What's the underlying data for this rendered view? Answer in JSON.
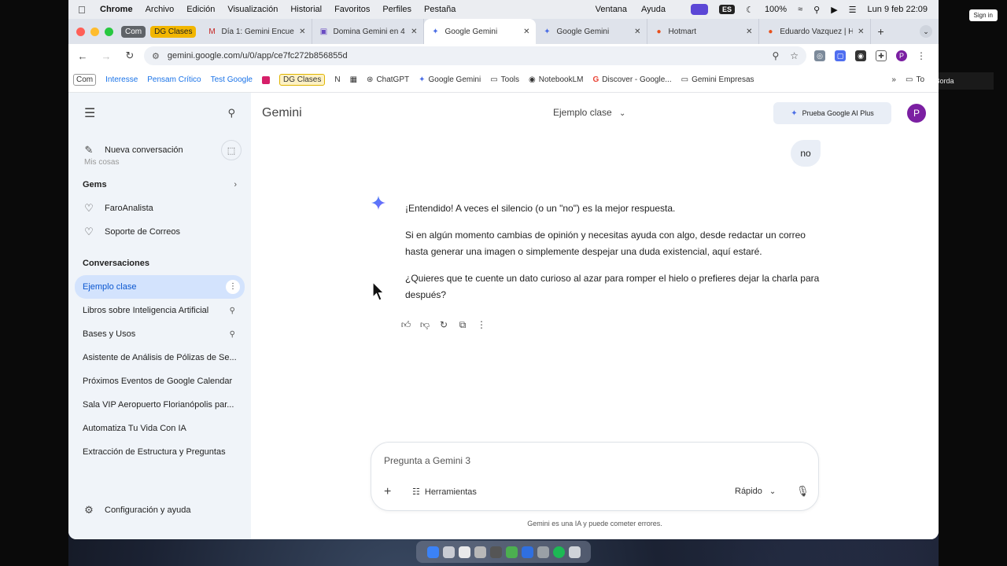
{
  "menubar": {
    "app": "Chrome",
    "items": [
      "Archivo",
      "Edición",
      "Visualización",
      "Historial",
      "Favoritos",
      "Perfiles",
      "Pestaña"
    ],
    "right_items": [
      "Ventana",
      "Ayuda"
    ],
    "input_source": "ES",
    "battery": "100%",
    "datetime": "Lun 9 feb  22:09"
  },
  "overlay": {
    "sign_in": "Sign in",
    "talking": "Talking: Paola Borda"
  },
  "tabs": {
    "groups": [
      {
        "label": "Com",
        "color": "#5f6368"
      },
      {
        "label": "DG Clases",
        "color": "#f2b600"
      }
    ],
    "items": [
      {
        "title": "Día 1: Gemini Encue",
        "active": false
      },
      {
        "title": "Domina Gemini en 4",
        "active": false
      },
      {
        "title": "Google Gemini",
        "active": true
      },
      {
        "title": "Google Gemini",
        "active": false
      },
      {
        "title": "Hotmart",
        "active": false
      },
      {
        "title": "Eduardo Vazquez | H",
        "active": false
      }
    ]
  },
  "address": {
    "url": "gemini.google.com/u/0/app/ce7fc272b856855d"
  },
  "bookmarks": {
    "items": [
      "Com",
      "Interesse",
      "Pensam Crítico",
      "Test Google",
      "DG Clases",
      "N",
      "ChatGPT",
      "Google Gemini",
      "Tools",
      "NotebookLM",
      "Discover - Google...",
      "Gemini Empresas",
      "To"
    ]
  },
  "sidebar": {
    "new_chat": "Nueva conversación",
    "my_stuff": "Mis cosas",
    "gems_title": "Gems",
    "gems": [
      "FaroAnalista",
      "Soporte de Correos"
    ],
    "conversations_title": "Conversaciones",
    "conversations": [
      "Ejemplo clase",
      "Libros sobre Inteligencia Artificial",
      "Bases y Usos",
      "Asistente de Análisis de Pólizas de Se...",
      "Próximos Eventos de Google Calendar",
      "Sala VIP Aeropuerto Florianópolis par...",
      "Automatiza Tu Vida Con IA",
      "Extracción de Estructura y Preguntas"
    ],
    "settings": "Configuración y ayuda"
  },
  "header": {
    "title": "Gemini",
    "chat_title": "Ejemplo clase",
    "promo": "Prueba Google AI Plus",
    "avatar_letter": "P"
  },
  "chat": {
    "user_message": "no",
    "response": [
      "¡Entendido! A veces el silencio (o un \"no\") es la mejor respuesta.",
      "Si en algún momento cambias de opinión y necesitas ayuda con algo, desde redactar un correo hasta generar una imagen o simplemente despejar una duda existencial, aquí estaré.",
      "¿Quieres que te cuente un dato curioso al azar para romper el hielo o prefieres dejar la charla para después?"
    ]
  },
  "composer": {
    "placeholder": "Pregunta a Gemini 3",
    "tools": "Herramientas",
    "mode": "Rápido",
    "disclaimer": "Gemini es una IA y puede cometer errores."
  }
}
